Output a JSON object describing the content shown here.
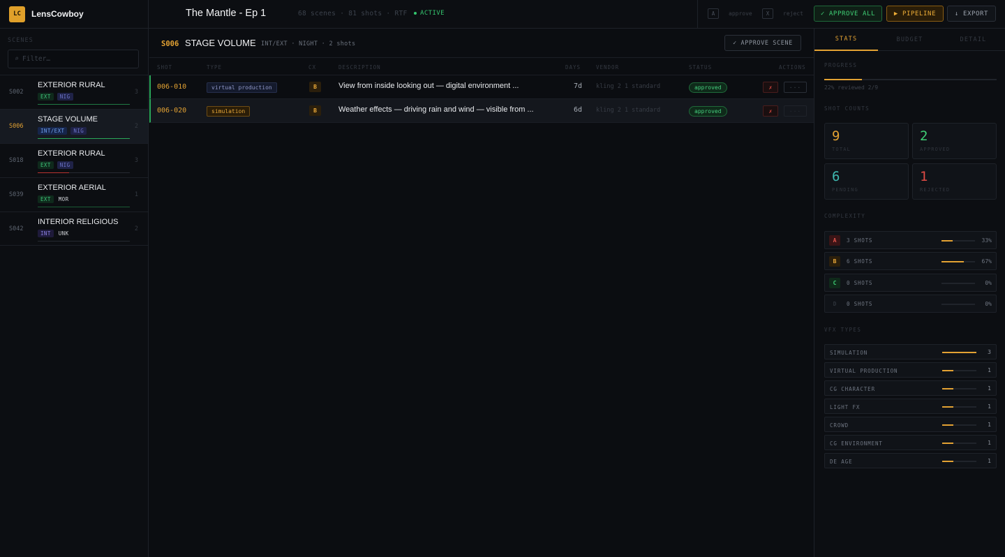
{
  "app": {
    "logo": "LC",
    "name": "LensCowboy"
  },
  "project": {
    "title": "The Mantle - Ep 1",
    "meta": "68 scenes · 81 shots · RTF",
    "status": "ACTIVE"
  },
  "shortcuts": [
    {
      "key": "A",
      "label": "approve"
    },
    {
      "key": "X",
      "label": "reject"
    }
  ],
  "toolbar": {
    "approve_all": "✓ APPROVE ALL",
    "pipeline": "▶ PIPELINE",
    "export": "↓ EXPORT"
  },
  "sidebar": {
    "label": "SCENES",
    "filter_icon": "⌕",
    "filter_placeholder": "Filter…",
    "scenes": [
      {
        "id": "S002",
        "name": "EXTERIOR RURAL",
        "tags": [
          "EXT",
          "NIG"
        ],
        "count": "3",
        "line_color": "#1f7a44"
      },
      {
        "id": "S006",
        "name": "STAGE VOLUME",
        "tags": [
          "INT/EXT",
          "NIG"
        ],
        "count": "2",
        "line_color": "#2aa85a",
        "active": true
      },
      {
        "id": "S018",
        "name": "EXTERIOR RURAL",
        "tags": [
          "EXT",
          "NIG"
        ],
        "count": "3",
        "line_color": "#b8332f"
      },
      {
        "id": "S039",
        "name": "EXTERIOR AERIAL",
        "tags": [
          "EXT",
          "MOR"
        ],
        "count": "1",
        "line_color": "#1f7a44"
      },
      {
        "id": "S042",
        "name": "INTERIOR RELIGIOUS",
        "tags": [
          "INT",
          "UNK"
        ],
        "count": "2",
        "line_color": "#262a31"
      }
    ]
  },
  "scene_header": {
    "id": "S006",
    "name": "STAGE VOLUME",
    "meta": "INT/EXT · NIGHT · 2 shots",
    "approve_scene": "✓ APPROVE SCENE"
  },
  "table": {
    "columns": [
      "SHOT",
      "TYPE",
      "CX",
      "DESCRIPTION",
      "DAYS",
      "VENDOR",
      "STATUS",
      "ACTIONS"
    ],
    "rows": [
      {
        "shot": "006-010",
        "type": "virtual production",
        "cx": "B",
        "description": "View from inside  looking out — digital environment ...",
        "days": "7d",
        "vendor": "kling 2 1 standard",
        "status": "approved",
        "reject": "✗",
        "more": "···"
      },
      {
        "shot": "006-020",
        "type": "simulation",
        "cx": "B",
        "description": "Weather effects — driving rain and wind — visible from ...",
        "days": "6d",
        "vendor": "kling 2 1 standard",
        "status": "approved",
        "reject": "✗",
        "more": "···"
      }
    ]
  },
  "right_panel": {
    "tabs": [
      "STATS",
      "BUDGET",
      "DETAIL"
    ],
    "progress": {
      "label": "PROGRESS",
      "value": 0.22,
      "text": "22% reviewed   2/9"
    },
    "shot_counts": {
      "label": "SHOT COUNTS",
      "items": [
        {
          "value": "9",
          "label": "TOTAL",
          "color": "#e3a233"
        },
        {
          "value": "2",
          "label": "APPROVED",
          "color": "#3fcf75"
        },
        {
          "value": "6",
          "label": "PENDING",
          "color": "#3fb8b0"
        },
        {
          "value": "1",
          "label": "REJECTED",
          "color": "#e04b45"
        }
      ]
    },
    "complexity": {
      "label": "COMPLEXITY",
      "items": [
        {
          "letter": "A",
          "shots": "3 SHOTS",
          "pct": "33%",
          "value": 0.33,
          "bg": "#3a1416",
          "fg": "#e0534b"
        },
        {
          "letter": "B",
          "shots": "6 SHOTS",
          "pct": "67%",
          "value": 0.67,
          "bg": "#2b1f0c",
          "fg": "#eeab39"
        },
        {
          "letter": "C",
          "shots": "0 SHOTS",
          "pct": "0%",
          "value": 0,
          "bg": "#0f2a1a",
          "fg": "#3fcf75"
        },
        {
          "letter": "D",
          "shots": "0 SHOTS",
          "pct": "0%",
          "value": 0,
          "bg": "#101318",
          "fg": "#2e333b"
        }
      ]
    },
    "vfx_types": {
      "label": "VFX TYPES",
      "items": [
        {
          "name": "SIMULATION",
          "count": "3",
          "value": 1.0
        },
        {
          "name": "VIRTUAL PRODUCTION",
          "count": "1",
          "value": 0.33
        },
        {
          "name": "CG CHARACTER",
          "count": "1",
          "value": 0.33
        },
        {
          "name": "LIGHT FX",
          "count": "1",
          "value": 0.33
        },
        {
          "name": "CROWD",
          "count": "1",
          "value": 0.33
        },
        {
          "name": "CG ENVIRONMENT",
          "count": "1",
          "value": 0.33
        },
        {
          "name": "DE AGE",
          "count": "1",
          "value": 0.33
        }
      ]
    }
  }
}
